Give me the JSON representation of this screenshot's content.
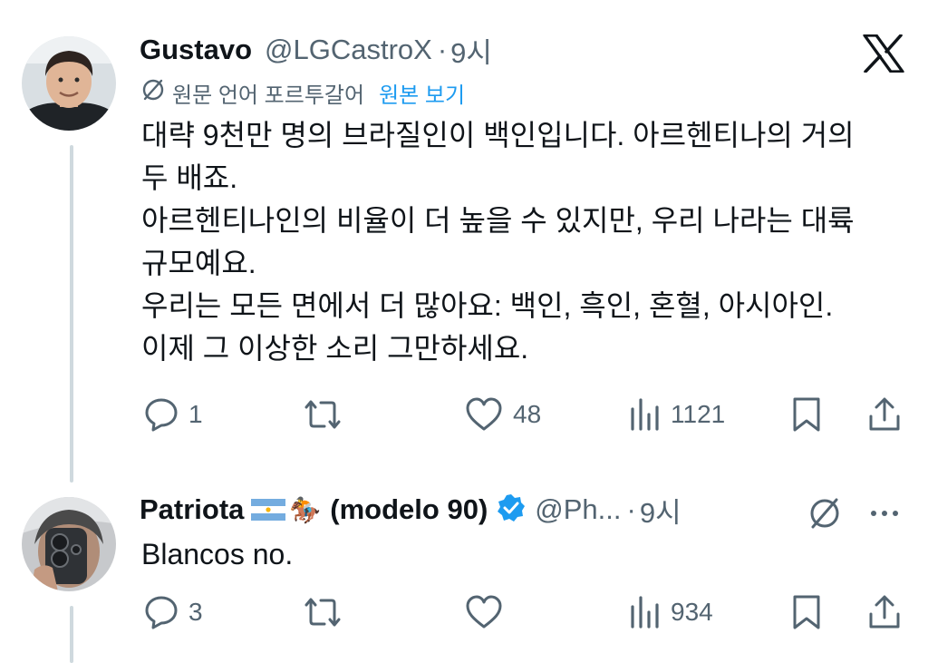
{
  "tweet1": {
    "name": "Gustavo",
    "handle": "@LGCastroX",
    "separator": "·",
    "time": "9시",
    "translation_note": "원문 언어 포르투갈어",
    "view_original": "원본 보기",
    "text": "대략 9천만 명의 브라질인이 백인입니다. 아르헨티나의 거의\n두 배죠.\n아르헨티나인의 비율이 더 높을 수 있지만, 우리 나라는 대륙\n규모예요.\n우리는 모든 면에서 더 많아요: 백인, 흑인, 혼혈, 아시아인.\n이제 그 이상한 소리 그만하세요.",
    "replies": "1",
    "retweets": "",
    "likes": "48",
    "views": "1121"
  },
  "tweet2": {
    "name_prefix": "Patriota",
    "emoji": "🏇",
    "name_suffix": "(modelo 90)",
    "handle": "@Ph...",
    "separator": "·",
    "time": "9시",
    "text": "Blancos no.",
    "replies": "3",
    "retweets": "",
    "likes": "",
    "views": "934"
  },
  "colors": {
    "text": "#0f1419",
    "secondary": "#536471",
    "link": "#1d9bf0",
    "verified": "#1d9bf0",
    "thread_line": "#cfd9de"
  },
  "icons": [
    "x-logo-icon",
    "translate-icon",
    "reply-icon",
    "retweet-icon",
    "like-icon",
    "views-icon",
    "bookmark-icon",
    "share-icon",
    "verified-badge-icon",
    "more-icon",
    "argentina-flag-icon"
  ]
}
